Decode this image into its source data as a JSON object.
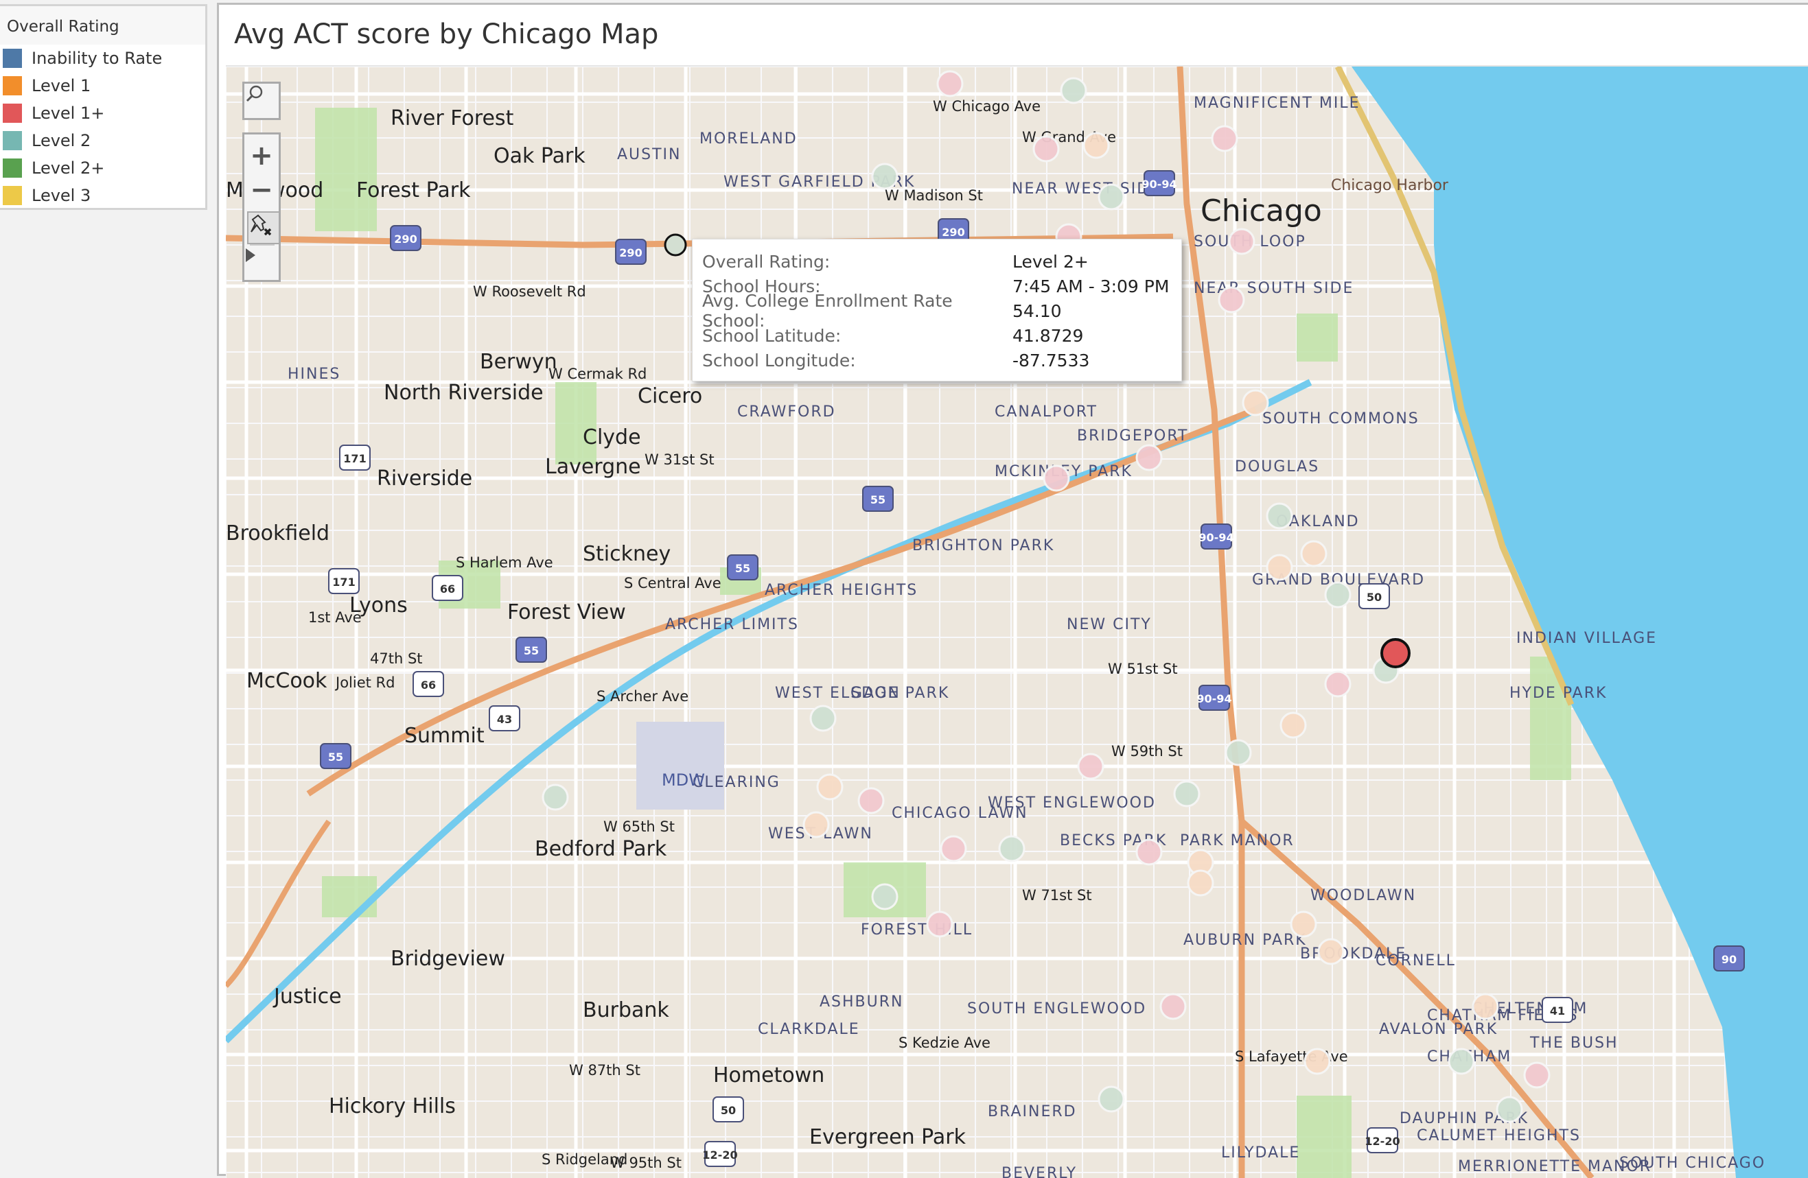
{
  "legend": {
    "title": "Overall Rating",
    "items": [
      {
        "label": "Inability to Rate",
        "color": "#4e79a7"
      },
      {
        "label": "Level 1",
        "color": "#f28e2b"
      },
      {
        "label": "Level 1+",
        "color": "#e15759"
      },
      {
        "label": "Level 2",
        "color": "#76b7b2"
      },
      {
        "label": "Level 2+",
        "color": "#59a14f"
      },
      {
        "label": "Level 3",
        "color": "#edc948"
      }
    ]
  },
  "sheet": {
    "title": "Avg ACT score by Chicago Map"
  },
  "map_controls": {
    "search_icon": "search-icon",
    "zoom_in": "+",
    "zoom_out": "−",
    "pin_icon": "pushpin-clear-icon",
    "expand_icon": "triangle-right-icon"
  },
  "tooltip": {
    "rows": [
      {
        "key": "Overall Rating:",
        "value": "Level 2+"
      },
      {
        "key": "School Hours:",
        "value": "7:45 AM - 3:09 PM"
      },
      {
        "key": "Avg. College Enrollment Rate School:",
        "value": "54.10"
      },
      {
        "key": "School Latitude:",
        "value": "41.8729"
      },
      {
        "key": "School Longitude:",
        "value": "-87.7533"
      }
    ]
  },
  "map_labels": {
    "cities": [
      "Oak Park",
      "Forest Park",
      "Berwyn",
      "Cicero",
      "Chicago",
      "Summit",
      "Bridgeview",
      "Burbank",
      "Evergreen Park",
      "Hickory Hills",
      "Lyons",
      "Forest View",
      "Stickney",
      "Riverside",
      "North Riverside",
      "River Forest",
      "Maywood",
      "Bedford Park",
      "Hometown",
      "Brookfield",
      "Justice",
      "McCook",
      "Clyde",
      "Lavergne"
    ],
    "neighborhoods": [
      "AUSTIN",
      "MORELAND",
      "WEST GARFIELD PARK",
      "NEAR WEST SIDE",
      "MAGNIFICENT MILE",
      "SOUTH LOOP",
      "NEAR SOUTH SIDE",
      "CANALPORT",
      "BRIDGEPORT",
      "MCKINLEY PARK",
      "DOUGLAS",
      "OAKLAND",
      "GRAND BOULEVARD",
      "INDIAN VILLAGE",
      "HYDE PARK",
      "NEW CITY",
      "BRIGHTON PARK",
      "ARCHER HEIGHTS",
      "ARCHER LIMITS",
      "WEST ELSDON",
      "GAGE PARK",
      "CLEARING",
      "WEST LAWN",
      "CHICAGO LAWN",
      "WEST ENGLEWOOD",
      "BECKS PARK",
      "PARK MANOR",
      "WOODLAWN",
      "BROOKDALE",
      "FOREST HILL",
      "AUBURN PARK",
      "CORNELL",
      "ASHBURN",
      "CLARKDALE",
      "SOUTH ENGLEWOOD",
      "CHATHAM FIELDS",
      "CHATHAM",
      "AVALON PARK",
      "CHELTENHAM",
      "THE BUSH",
      "BRAINERD",
      "DAUPHIN PARK",
      "CALUMET HEIGHTS",
      "LILYDALE",
      "MERRIONETTE MANOR",
      "SOUTH CHICAGO",
      "BEVERLY",
      "HINES",
      "CRAWFORD",
      "SOUTH COMMONS"
    ],
    "streets": [
      "W Chicago Ave",
      "W Grand Ave",
      "W Madison St",
      "W Roosevelt Rd",
      "W Cermak Rd",
      "W 31st St",
      "S Harlem Ave",
      "S Central Ave",
      "47th St",
      "Joliet Rd",
      "1st Ave",
      "S Archer Ave",
      "W 51st St",
      "W 59th St",
      "W 65th St",
      "W 71st St",
      "W 87th St",
      "W 95th St",
      "S Kedzie Ave",
      "S Lafayette Ave",
      "S Ridgeland"
    ],
    "poi": [
      "Chicago Harbor",
      "MDW"
    ],
    "shields": [
      "290",
      "290",
      "290",
      "90-94",
      "90-94",
      "90-94",
      "55",
      "55",
      "55",
      "55",
      "171",
      "171",
      "66",
      "66",
      "43",
      "50",
      "50",
      "41",
      "90",
      "12-20",
      "12-20"
    ]
  },
  "schools": [
    {
      "lat": 41.8729,
      "lon": -87.7533,
      "rating": "Level 2+",
      "selected": false,
      "hovered": true
    },
    {
      "lat": 41.8003,
      "lon": -87.592,
      "rating": "Level 1+",
      "selected": true
    }
  ]
}
